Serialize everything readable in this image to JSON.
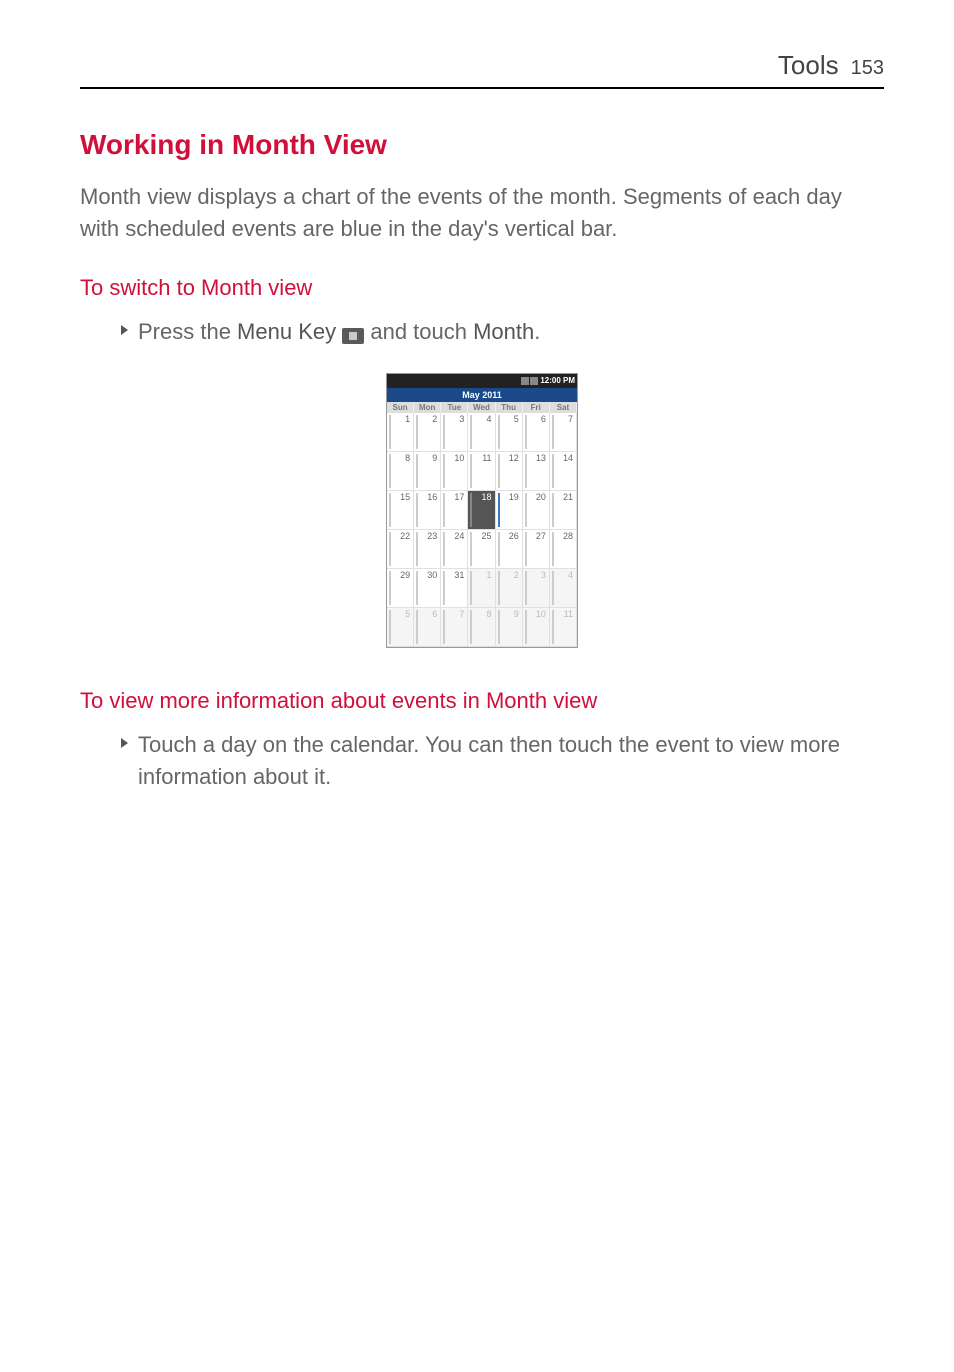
{
  "header": {
    "section": "Tools",
    "page": "153"
  },
  "heading": "Working in Month View",
  "intro": "Month view displays a chart of the events of the month. Segments of each day with scheduled events are blue in the day's vertical bar.",
  "sub1": "To switch to Month view",
  "bullet1_pre": "Press the ",
  "bullet1_bold1": "Menu Key",
  "bullet1_mid": " and touch ",
  "bullet1_bold2": "Month",
  "bullet1_post": ".",
  "sub2": "To view more information about events in Month view",
  "bullet2": "Touch a day on the calendar. You can then touch the event to view more information about it.",
  "phone": {
    "time": "12:00 PM",
    "month": "May 2011",
    "dow": [
      "Sun",
      "Mon",
      "Tue",
      "Wed",
      "Thu",
      "Fri",
      "Sat"
    ],
    "cells": [
      {
        "n": "1"
      },
      {
        "n": "2"
      },
      {
        "n": "3"
      },
      {
        "n": "4"
      },
      {
        "n": "5"
      },
      {
        "n": "6"
      },
      {
        "n": "7"
      },
      {
        "n": "8"
      },
      {
        "n": "9"
      },
      {
        "n": "10"
      },
      {
        "n": "11"
      },
      {
        "n": "12"
      },
      {
        "n": "13"
      },
      {
        "n": "14"
      },
      {
        "n": "15"
      },
      {
        "n": "16"
      },
      {
        "n": "17"
      },
      {
        "n": "18",
        "today": true
      },
      {
        "n": "19",
        "ev": true
      },
      {
        "n": "20"
      },
      {
        "n": "21"
      },
      {
        "n": "22"
      },
      {
        "n": "23"
      },
      {
        "n": "24"
      },
      {
        "n": "25"
      },
      {
        "n": "26"
      },
      {
        "n": "27"
      },
      {
        "n": "28"
      },
      {
        "n": "29"
      },
      {
        "n": "30"
      },
      {
        "n": "31"
      },
      {
        "n": "1",
        "other": true
      },
      {
        "n": "2",
        "other": true
      },
      {
        "n": "3",
        "other": true
      },
      {
        "n": "4",
        "other": true
      },
      {
        "n": "5",
        "other": true
      },
      {
        "n": "6",
        "other": true
      },
      {
        "n": "7",
        "other": true
      },
      {
        "n": "8",
        "other": true
      },
      {
        "n": "9",
        "other": true
      },
      {
        "n": "10",
        "other": true
      },
      {
        "n": "11",
        "other": true
      }
    ]
  }
}
